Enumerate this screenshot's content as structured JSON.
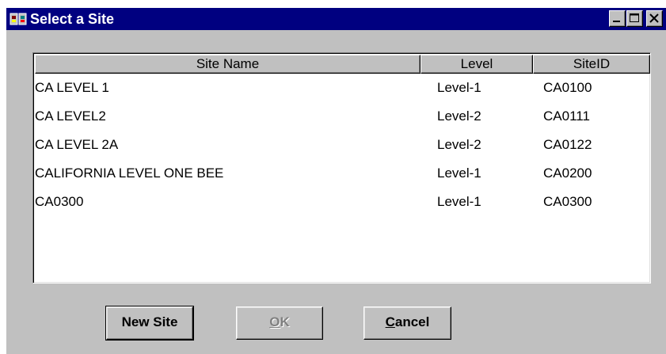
{
  "window": {
    "title": "Select a Site",
    "controls": [
      "minimize-icon",
      "maximize-icon",
      "close-icon"
    ]
  },
  "list": {
    "columns": [
      "Site Name",
      "Level",
      "SiteID"
    ],
    "rows": [
      {
        "name": "CA LEVEL 1",
        "level": "Level-1",
        "site_id": "CA0100"
      },
      {
        "name": "CA LEVEL2",
        "level": "Level-2",
        "site_id": "CA0111"
      },
      {
        "name": "CA LEVEL 2A",
        "level": "Level-2",
        "site_id": "CA0122"
      },
      {
        "name": "CALIFORNIA LEVEL ONE BEE",
        "level": "Level-1",
        "site_id": "CA0200"
      },
      {
        "name": "CA0300",
        "level": "Level-1",
        "site_id": "CA0300"
      }
    ]
  },
  "buttons": {
    "new_site": "New Site",
    "ok_mnemonic": "O",
    "ok_rest": "K",
    "cancel_mnemonic": "C",
    "cancel_rest": "ancel"
  },
  "colors": {
    "titlebar": "#000080",
    "face": "#c0c0c0",
    "disabled_text": "#808080"
  }
}
